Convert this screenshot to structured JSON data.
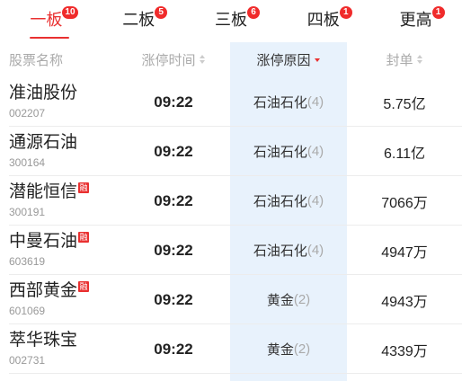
{
  "tabs": [
    {
      "label": "一板",
      "badge": "10",
      "active": true
    },
    {
      "label": "二板",
      "badge": "5",
      "active": false
    },
    {
      "label": "三板",
      "badge": "6",
      "active": false
    },
    {
      "label": "四板",
      "badge": "1",
      "active": false
    },
    {
      "label": "更高",
      "badge": "1",
      "active": false
    }
  ],
  "columns": [
    {
      "label": "股票名称"
    },
    {
      "label": "涨停时间",
      "icon": "sort-updown-icon"
    },
    {
      "label": "涨停原因",
      "icon": "sort-down-icon",
      "active": true
    },
    {
      "label": "封单",
      "icon": "sort-updown-icon"
    }
  ],
  "rows": [
    {
      "name": "准油股份",
      "code": "002207",
      "time": "09:22",
      "reason": "石油石化",
      "reason_count": "(4)",
      "amount": "5.75亿"
    },
    {
      "name": "通源石油",
      "code": "300164",
      "time": "09:22",
      "reason": "石油石化",
      "reason_count": "(4)",
      "amount": "6.11亿"
    },
    {
      "name": "潜能恒信",
      "tag": "融",
      "code": "300191",
      "time": "09:22",
      "reason": "石油石化",
      "reason_count": "(4)",
      "amount": "7066万"
    },
    {
      "name": "中曼石油",
      "tag": "融",
      "code": "603619",
      "time": "09:22",
      "reason": "石油石化",
      "reason_count": "(4)",
      "amount": "4947万"
    },
    {
      "name": "西部黄金",
      "tag": "融",
      "code": "601069",
      "time": "09:22",
      "reason": "黄金",
      "reason_count": "(2)",
      "amount": "4943万"
    },
    {
      "name": "萃华珠宝",
      "code": "002731",
      "time": "09:22",
      "reason": "黄金",
      "reason_count": "(2)",
      "amount": "4339万"
    }
  ],
  "colors": {
    "accent": "#e93030",
    "badge": "#f02b2b",
    "highlight_column": "#e8f2fc",
    "text": "#222222",
    "muted": "#999999"
  }
}
